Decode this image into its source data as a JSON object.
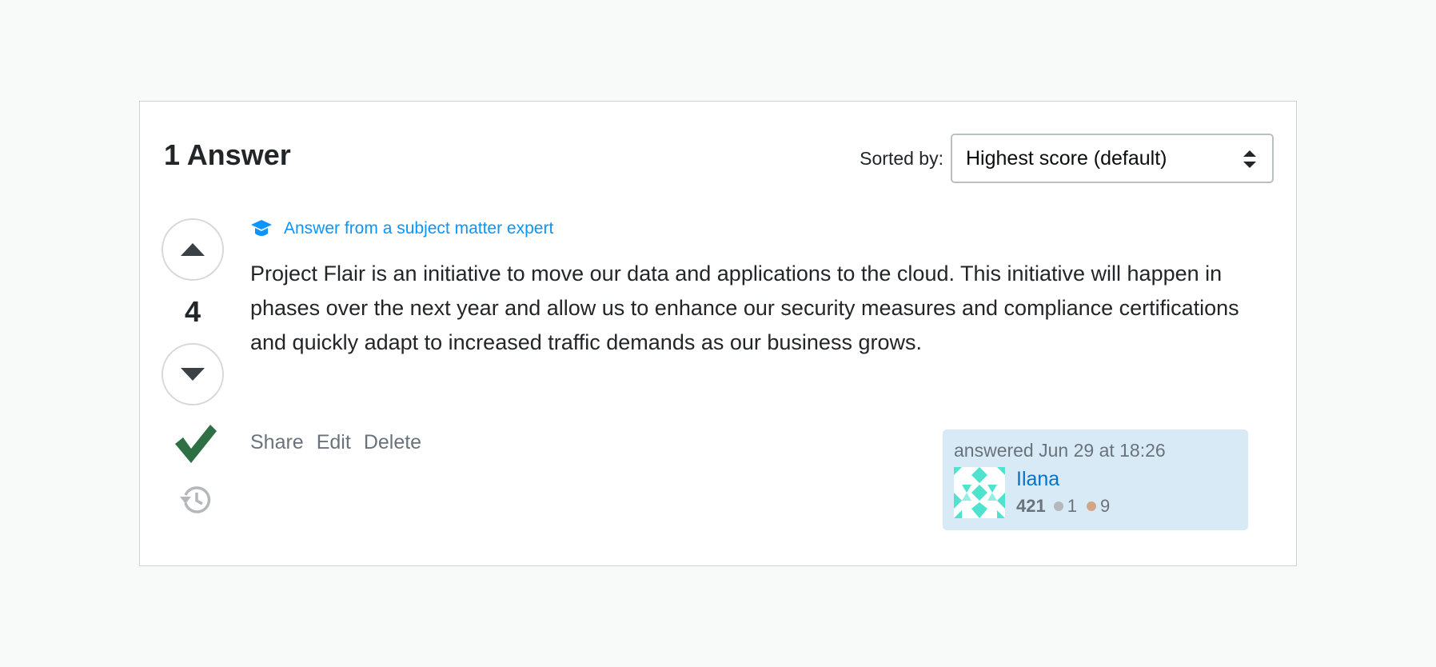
{
  "header": {
    "answer_count": "1 Answer",
    "sort_label": "Sorted by:",
    "sort_value": "Highest score (default)"
  },
  "vote": {
    "score": "4"
  },
  "answer": {
    "sme_label": "Answer from a subject matter expert",
    "body": "Project Flair is an initiative to move our data and applications to the cloud. This initiative will happen in phases over the next year and allow us to enhance our security measures and compliance certifications and quickly adapt to increased traffic demands as our business grows."
  },
  "actions": {
    "share": "Share",
    "edit": "Edit",
    "delete": "Delete"
  },
  "signature": {
    "answered_time": "answered Jun 29 at 18:26",
    "user_name": "Ilana",
    "reputation": "421",
    "silver_badges": "1",
    "bronze_badges": "9"
  },
  "colors": {
    "accent_blue": "#0a95ff",
    "link_blue": "#0074cc",
    "accepted_green": "#2f6f44",
    "signature_bg": "#d9eaf7",
    "avatar_teal": "#4fe3cf",
    "silver": "#b4b8bc",
    "bronze": "#d1a684"
  },
  "icons": {
    "sme": "graduation-cap-icon",
    "upvote": "caret-up-icon",
    "downvote": "caret-down-icon",
    "accepted": "checkmark-icon",
    "history": "history-icon",
    "sort": "sort-arrows-icon"
  }
}
